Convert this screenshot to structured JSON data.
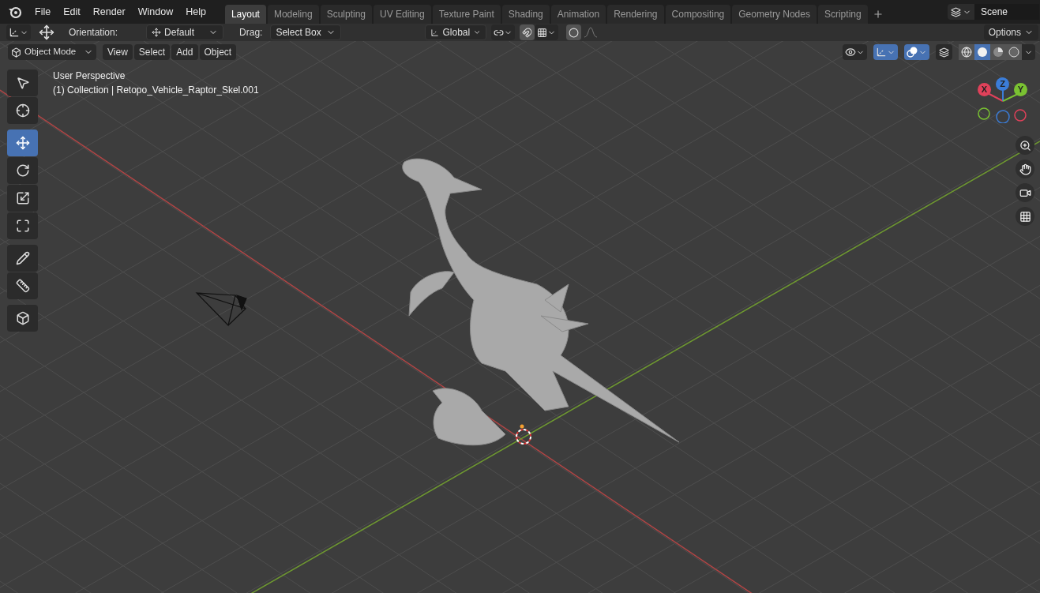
{
  "menu": [
    "File",
    "Edit",
    "Render",
    "Window",
    "Help"
  ],
  "workspaces": [
    {
      "label": "Layout",
      "selected": true
    },
    {
      "label": "Modeling",
      "selected": false
    },
    {
      "label": "Sculpting",
      "selected": false
    },
    {
      "label": "UV Editing",
      "selected": false
    },
    {
      "label": "Texture Paint",
      "selected": false
    },
    {
      "label": "Shading",
      "selected": false
    },
    {
      "label": "Animation",
      "selected": false
    },
    {
      "label": "Rendering",
      "selected": false
    },
    {
      "label": "Compositing",
      "selected": false
    },
    {
      "label": "Geometry Nodes",
      "selected": false
    },
    {
      "label": "Scripting",
      "selected": false
    }
  ],
  "scene": "Scene",
  "tool_header": {
    "orientation_label": "Orientation:",
    "orientation": "Default",
    "drag_label": "Drag:",
    "drag": "Select Box",
    "transform": "Global",
    "snap": false,
    "proportional": false,
    "options": "Options"
  },
  "view_header": {
    "mode": "Object Mode",
    "menus": [
      "View",
      "Select",
      "Add",
      "Object"
    ],
    "gizmos": true,
    "overlays": true,
    "xray": false,
    "shading": [
      {
        "kind": "wireframe",
        "selected": false
      },
      {
        "kind": "solid",
        "selected": true
      },
      {
        "kind": "material",
        "selected": false
      },
      {
        "kind": "rendered",
        "selected": false
      }
    ]
  },
  "tools": [
    {
      "kind": "select",
      "selected": false
    },
    {
      "kind": "cursor",
      "selected": false
    },
    {
      "kind": "move",
      "selected": true
    },
    {
      "kind": "rotate",
      "selected": false
    },
    {
      "kind": "scale",
      "selected": false
    },
    {
      "kind": "transform",
      "selected": false
    },
    {
      "kind": "annotate",
      "selected": false
    },
    {
      "kind": "measure",
      "selected": false
    },
    {
      "kind": "add",
      "selected": false
    }
  ],
  "viewport": {
    "view_name": "User Perspective",
    "object_info": "(1) Collection | Retopo_Vehicle_Raptor_Skel.001"
  },
  "gizmo": {
    "axes": [
      {
        "label": "X",
        "color": "#e0415a"
      },
      {
        "label": "Z",
        "color": "#3b7dd8"
      },
      {
        "label": "Y",
        "color": "#7ac232"
      }
    ]
  }
}
